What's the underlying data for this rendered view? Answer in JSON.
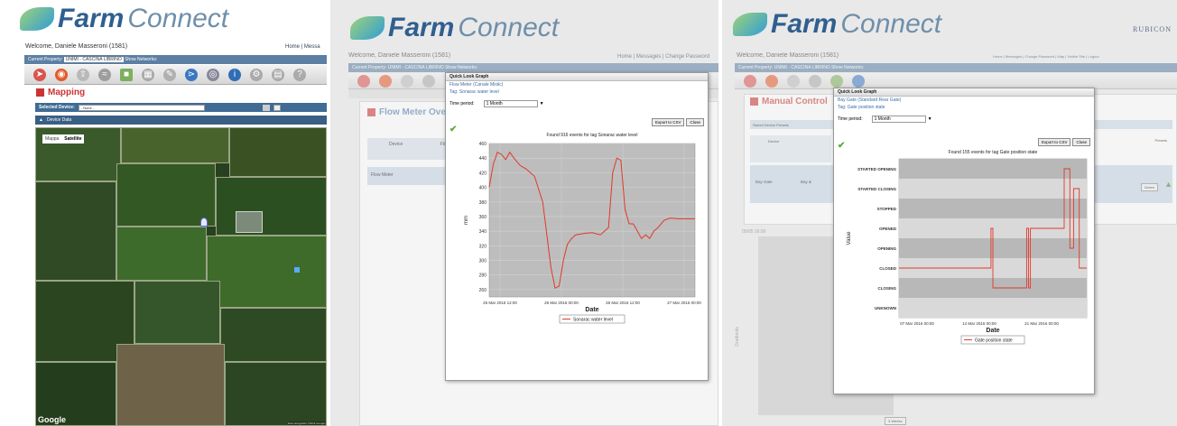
{
  "app": {
    "name_bold": "Farm",
    "name_light": "Connect"
  },
  "screen1": {
    "welcome": "Welcome, Daniele Masseroni (1581)",
    "links": "Home | Messa",
    "property_label": "Current Property:",
    "property_value": "UNIMI - CASCINA LIBRINO",
    "show_networks": "Show Networks:",
    "section_title": "Mapping",
    "selected_device_label": "Selected Device:",
    "selected_device_value": "- None -",
    "device_data": "Device Data",
    "map_tabs": [
      "Mappa",
      "Satellite"
    ],
    "google": "Google",
    "map_copyright": "Dati cartografici ©2016 Google"
  },
  "screen2": {
    "welcome": "Welcome, Daniele Masseroni (1581)",
    "links": "Home | Messages | Change Password",
    "property_label": "Current Property:",
    "property_value": "UNIMI - CASCINA LIBRINO",
    "show_networks": "Show Networks:",
    "section_title": "Flow Meter Overvi",
    "table_headers": [
      "Device",
      "Flow"
    ],
    "row_device": "Flow Meter",
    "dialog_title": "Quick Look Graph",
    "dialog_sub1": "Flow Meter (Canale Mistic)",
    "dialog_sub2": "Tag: Sonarac water level",
    "time_period_label": "Time period:",
    "time_period_value": "1 Month",
    "export_btn": "Export to CSV",
    "close_btn": "Close"
  },
  "screen3": {
    "welcome": "Welcome, Daniele Masseroni (1581)",
    "links": "Home | Messages | Change Password | Map | Visible Site | Logout",
    "property_label": "Current Property:",
    "property_value": "UNIMI - CASCINA LIBRINO",
    "show_networks": "Show Networks:",
    "brand": "RUBICON",
    "section_title": "Manual Control",
    "stored_device": "Stored Device Presets",
    "table_header": "Device",
    "row_device": "Bay Gate",
    "row_col2": "Bay &",
    "row_btn": "Green",
    "row_header_right": "Presets",
    "left_date": "05/05 16:00",
    "left_axis": "Gradients",
    "bottom_btn": "3 Weeks",
    "dialog_title": "Quick Look Graph",
    "dialog_sub1": "Bay Gate (Standard Rear Gate)",
    "dialog_sub2": "Tag: Gate position state",
    "time_period_label": "Time period:",
    "time_period_value": "1 Month",
    "export_btn": "Export to CSV",
    "close_btn": "Close"
  },
  "chart_data": [
    {
      "type": "line",
      "title": "Found 916 events for tag Sonarac water level",
      "xlabel": "Date",
      "ylabel": "mm",
      "ylim": [
        250,
        460
      ],
      "yticks": [
        "460",
        "440",
        "420",
        "400",
        "380",
        "360",
        "340",
        "320",
        "300",
        "280",
        "260"
      ],
      "xticks": [
        "25 Mar 2016 12:00",
        "26 Mar 2016 00:00",
        "26 Mar 2016 12:00",
        "27 Mar 2016 00:00"
      ],
      "legend": "Sonarac water level",
      "series": [
        {
          "name": "Sonarac water level",
          "color": "#e0392b",
          "x": [
            0.0,
            0.02,
            0.04,
            0.06,
            0.08,
            0.1,
            0.12,
            0.15,
            0.18,
            0.22,
            0.26,
            0.3,
            0.32,
            0.34,
            0.36,
            0.38,
            0.4,
            0.42,
            0.46,
            0.5,
            0.54,
            0.58,
            0.6,
            0.62,
            0.64,
            0.66,
            0.68,
            0.7,
            0.72,
            0.74,
            0.76,
            0.78,
            0.8,
            0.82,
            0.85,
            0.88,
            0.92,
            0.96,
            1.0
          ],
          "y": [
            400,
            432,
            448,
            445,
            438,
            448,
            440,
            430,
            425,
            415,
            380,
            290,
            262,
            265,
            300,
            322,
            330,
            335,
            337,
            338,
            335,
            345,
            420,
            440,
            437,
            370,
            350,
            350,
            340,
            330,
            335,
            330,
            340,
            345,
            355,
            358,
            357,
            357,
            357
          ]
        }
      ]
    },
    {
      "type": "line",
      "title": "Found 155 events for tag Gate position state",
      "xlabel": "Date",
      "ylabel": "Value",
      "categories": [
        "UNKNOWN",
        "CLOSING",
        "CLOSED",
        "OPENING",
        "OPENED",
        "STOPPED",
        "STARTED CLOSING",
        "STARTED OPENING"
      ],
      "xticks": [
        "07 Mar 2016 00:00",
        "14 Mar 2016 00:00",
        "21 Mar 2016 00:00"
      ],
      "legend": "Gate position state",
      "series": [
        {
          "name": "Gate position state",
          "color": "#e0392b",
          "x": [
            0.0,
            0.49,
            0.49,
            0.5,
            0.5,
            0.68,
            0.68,
            0.69,
            0.69,
            0.7,
            0.7,
            0.88,
            0.88,
            0.91,
            0.91,
            0.93,
            0.93,
            0.96,
            0.96,
            1.0
          ],
          "y": [
            2,
            2,
            4,
            4,
            1,
            1,
            4,
            4,
            1,
            1,
            4,
            4,
            7,
            7,
            3,
            3,
            6,
            6,
            2,
            2
          ]
        }
      ]
    }
  ]
}
